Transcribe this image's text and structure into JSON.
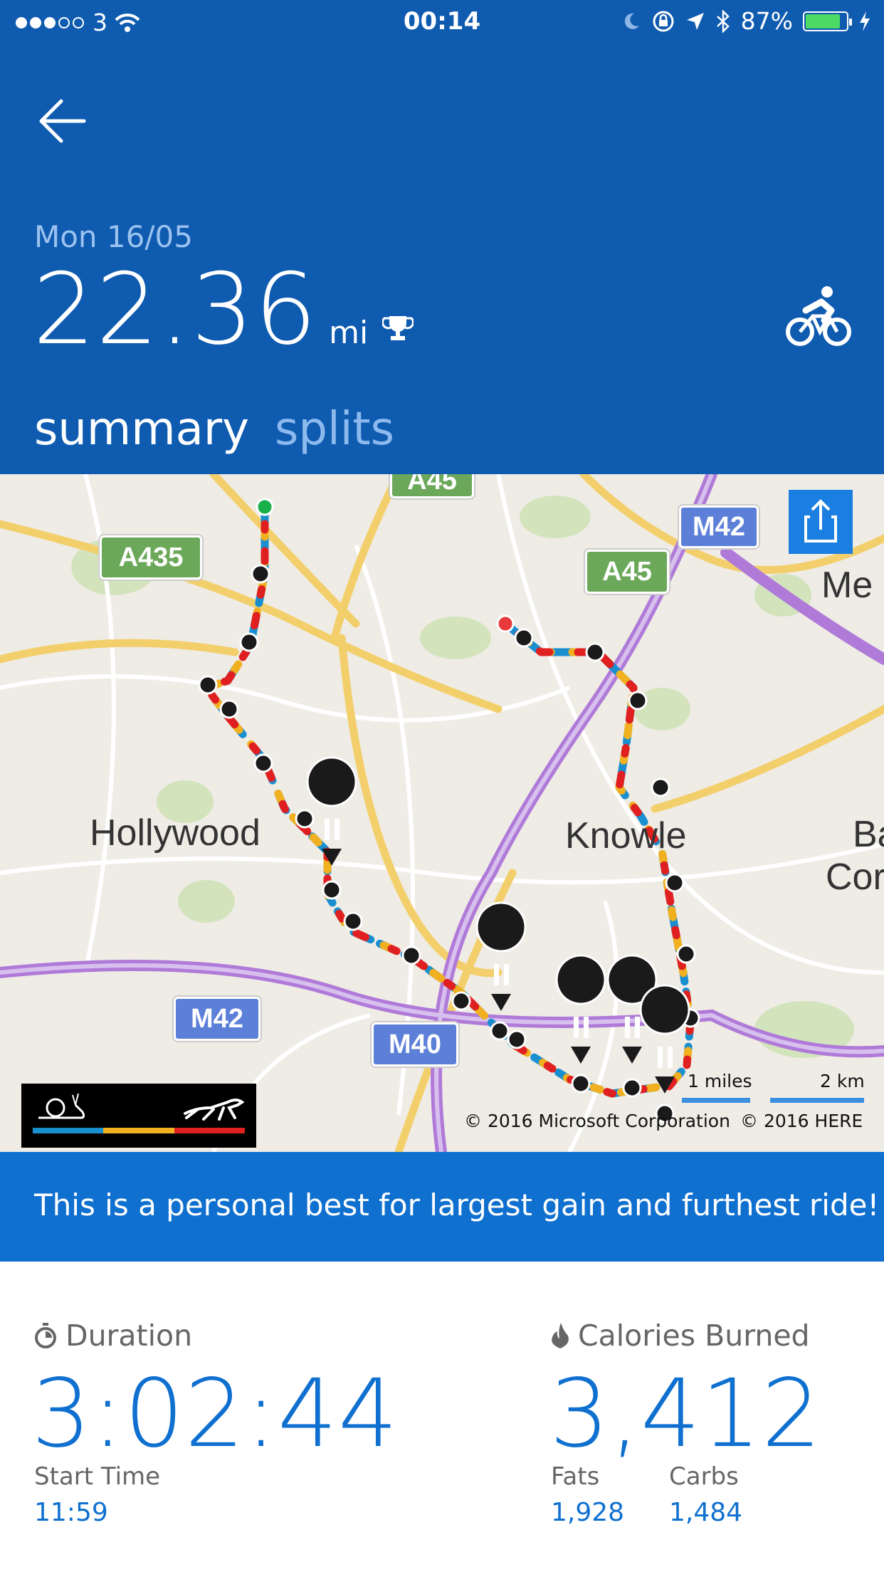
{
  "status_bar": {
    "carrier": "3",
    "time": "00:14",
    "battery_percent_text": "87%",
    "battery_level": 0.87
  },
  "header": {
    "date": "Mon 16/05",
    "distance_value": "22.36",
    "distance_unit": "mi",
    "activity_icon": "bike-icon",
    "tabs": [
      {
        "label": "summary",
        "active": true
      },
      {
        "label": "splits",
        "active": false
      }
    ]
  },
  "map": {
    "place_labels": [
      "Hollywood",
      "Knowle",
      "Me",
      "Ba",
      "Cor"
    ],
    "road_labels": [
      "A435",
      "A45",
      "A45",
      "M42",
      "M42",
      "M40"
    ],
    "scale_miles": "1 miles",
    "scale_km": "2 km",
    "copyright_ms": "© 2016 Microsoft Corporation",
    "copyright_here": "© 2016 HERE"
  },
  "banner": {
    "text": "This is a personal best for largest gain and furthest ride!"
  },
  "stats": {
    "duration_label": "Duration",
    "duration_value": "3:02:44",
    "start_time_label": "Start Time",
    "start_time_value": "11:59",
    "calories_label": "Calories Burned",
    "calories_value": "3,412",
    "fats_label": "Fats",
    "fats_value": "1,928",
    "carbs_label": "Carbs",
    "carbs_value": "1,484"
  },
  "colors": {
    "header_bg": "#0f5bb0",
    "banner_bg": "#0f70d0",
    "accent": "#0f70d0",
    "pace_slow": "#1a8fd0",
    "pace_mid": "#f0b020",
    "pace_fast": "#e02020"
  }
}
